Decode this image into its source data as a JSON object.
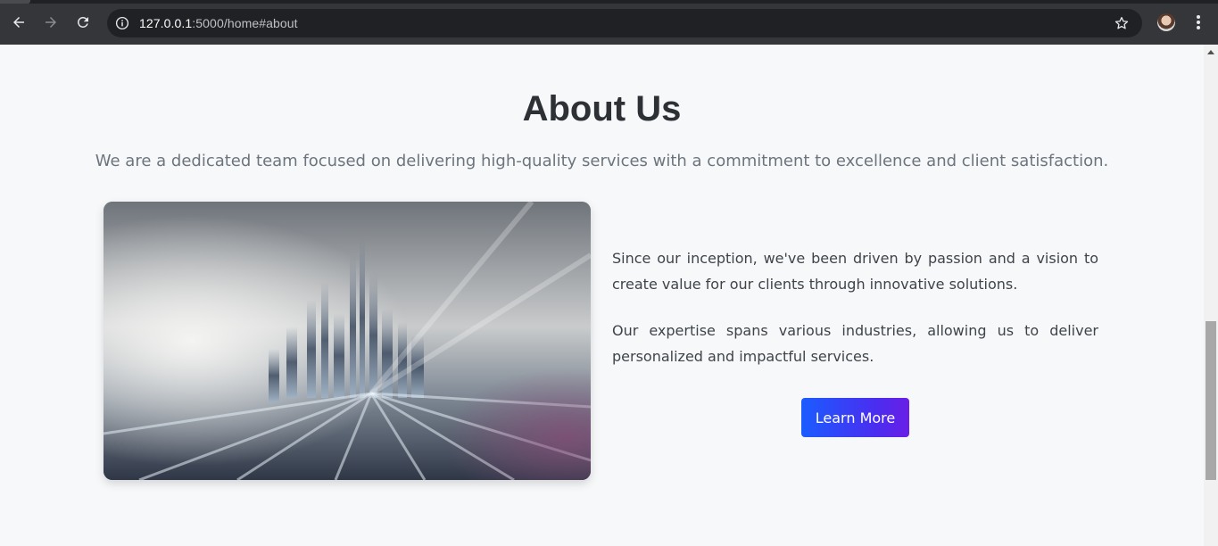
{
  "browser": {
    "url_host": "127.0.0.1",
    "url_rest": ":5000/home#about",
    "icons": [
      "back-icon",
      "forward-icon",
      "reload-icon",
      "info-icon",
      "star-icon",
      "avatar",
      "menu-icon"
    ]
  },
  "about": {
    "title": "About Us",
    "subtitle": "We are a dedicated team focused on delivering high-quality services with a commitment to excellence and client satisfaction.",
    "paragraph1": "Since our inception, we've been driven by passion and a vision to create value for our clients through innovative solutions.",
    "paragraph2": "Our expertise spans various industries, allowing us to deliver personalized and impactful services.",
    "cta_label": "Learn More"
  },
  "colors": {
    "page_bg": "#f7f8fa",
    "title": "#2d3136",
    "subtitle": "#6c757d",
    "button_start": "#1a5cff",
    "button_end": "#6a1fe6"
  }
}
